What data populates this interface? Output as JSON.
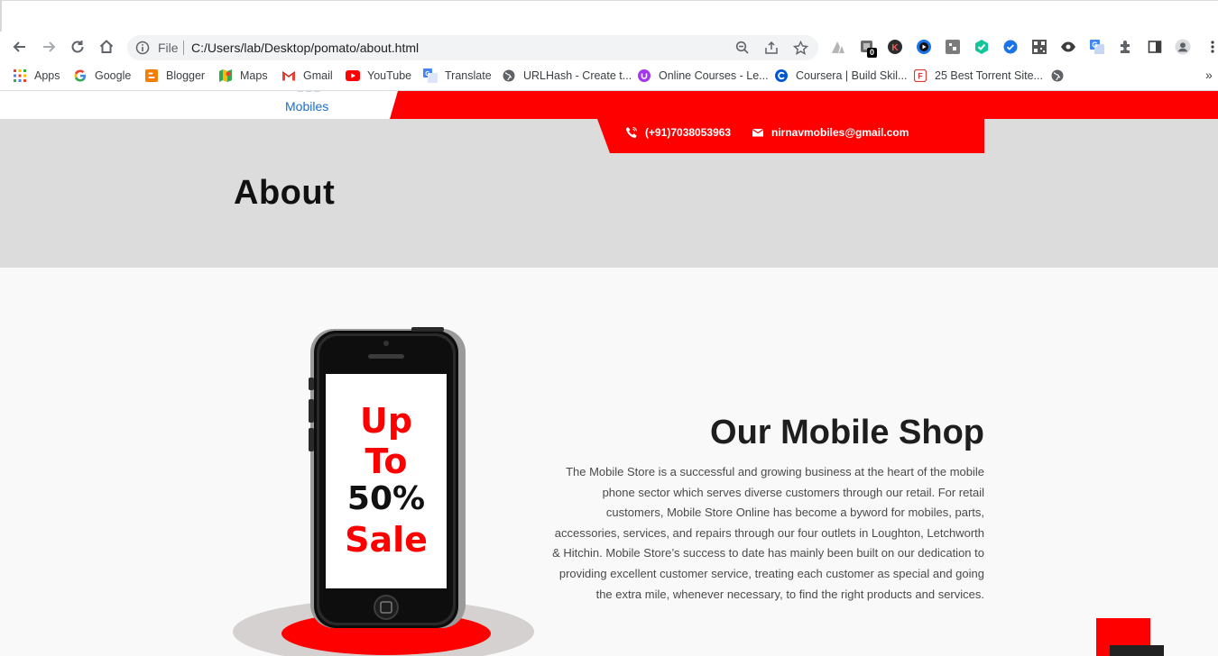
{
  "browser": {
    "omnibox": {
      "scheme_label": "File",
      "url": "C:/Users/lab/Desktop/pomato/about.html"
    },
    "extension_badge": "0",
    "bookmarks": [
      {
        "label": "Apps",
        "icon": "apps-grid-icon"
      },
      {
        "label": "Google",
        "icon": "google-icon"
      },
      {
        "label": "Blogger",
        "icon": "blogger-icon"
      },
      {
        "label": "Maps",
        "icon": "maps-icon"
      },
      {
        "label": "Gmail",
        "icon": "gmail-icon"
      },
      {
        "label": "YouTube",
        "icon": "youtube-icon"
      },
      {
        "label": "Translate",
        "icon": "translate-icon"
      },
      {
        "label": "URLHash - Create t...",
        "icon": "globe-icon"
      },
      {
        "label": "Online Courses - Le...",
        "icon": "udemy-icon"
      },
      {
        "label": "Coursera | Build Skil...",
        "icon": "coursera-icon"
      },
      {
        "label": "25 Best Torrent Site...",
        "icon": "torrent-site-icon"
      }
    ],
    "bookmarks_more": "»"
  },
  "site": {
    "logo_text": "Mobiles",
    "contact": {
      "phone": "(+91)7038053963",
      "email": "nirnavmobiles@gmail.com"
    },
    "page_title": "About",
    "section": {
      "title": "Our Mobile Shop",
      "description": "The Mobile Store is a successful and growing business at the heart of the mobile phone sector which serves diverse customers through our retail. For retail customers, Mobile Store Online has become a byword for mobiles, parts, accessories, services, and repairs through our four outlets in Loughton, Letchworth & Hitchin. Mobile Store’s success to date has mainly been built on our dedication to providing excellent customer service, treating each customer as special and going the extra mile, whenever necessary, to find the right products and services."
    },
    "promo": {
      "line1": "Up",
      "line2": "To",
      "line3": "50%",
      "line4": "Sale"
    }
  },
  "colors": {
    "brand_red": "#ff0000",
    "hero_gray": "#dcdcdc",
    "link_blue": "#1a6fc6"
  }
}
